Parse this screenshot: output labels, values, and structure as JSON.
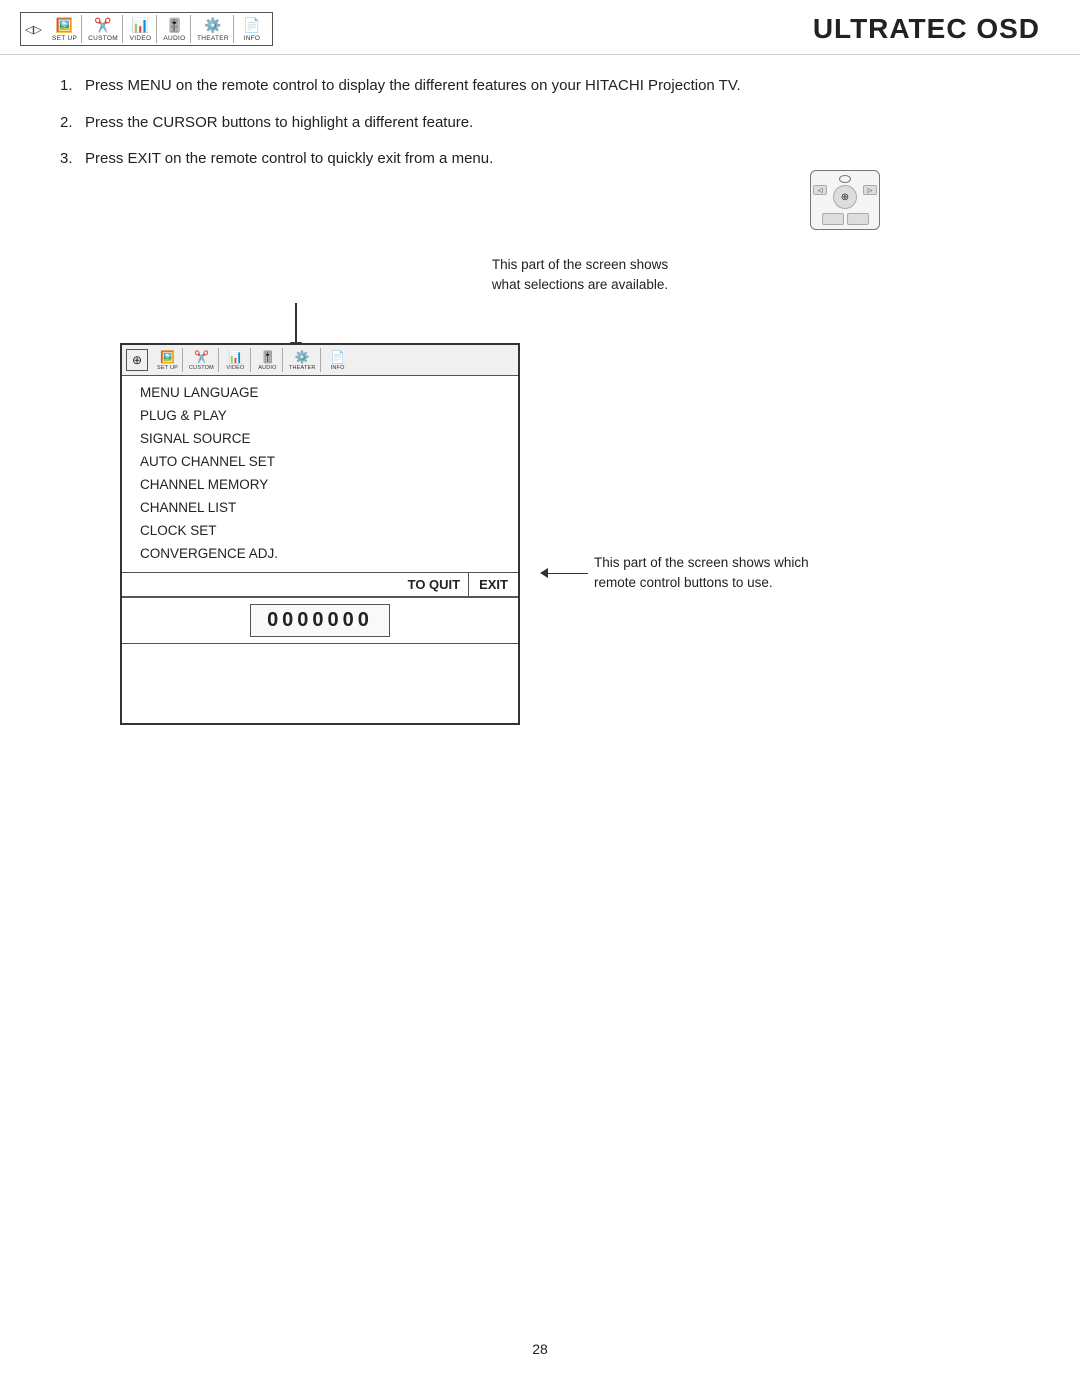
{
  "header": {
    "title": "ULTRATEC OSD"
  },
  "top_icons": [
    {
      "label": "SET UP",
      "icon": "◁▷"
    },
    {
      "label": "CUSTOM",
      "icon": "🖼"
    },
    {
      "label": "VIDEO",
      "icon": "📊"
    },
    {
      "label": "AUDIO",
      "icon": "🎚"
    },
    {
      "label": "THEATER",
      "icon": "⚙"
    },
    {
      "label": "INFO",
      "icon": "📄"
    }
  ],
  "instructions": [
    {
      "num": "1.",
      "text": "Press MENU on the remote control to display the different features on your HITACHI Projection TV."
    },
    {
      "num": "2.",
      "text": "Press the CURSOR buttons to highlight a different feature."
    },
    {
      "num": "3.",
      "text": "Press EXIT on the remote control to quickly exit from a menu."
    }
  ],
  "callout_top": {
    "line1": "This part of the screen shows",
    "line2": "what selections are available."
  },
  "tv_menu": {
    "icons": [
      {
        "label": "SET UP",
        "icon": "◁▷"
      },
      {
        "label": "CUSTOM",
        "icon": "🖼"
      },
      {
        "label": "VIDEO",
        "icon": "📊"
      },
      {
        "label": "AUDIO",
        "icon": "🎚"
      },
      {
        "label": "THEATER",
        "icon": "⚙"
      },
      {
        "label": "INFO",
        "icon": "📄"
      }
    ],
    "menu_items": [
      "MENU LANGUAGE",
      "PLUG & PLAY",
      "SIGNAL SOURCE",
      "AUTO CHANNEL SET",
      "CHANNEL MEMORY",
      "CHANNEL LIST",
      "CLOCK SET",
      "CONVERGENCE ADJ."
    ],
    "bottom_quit": "TO QUIT",
    "bottom_exit": "EXIT",
    "channel_display": "0000000"
  },
  "callout_right": {
    "line1": "This part of the screen shows which",
    "line2": "remote control buttons to use."
  },
  "page_number": "28"
}
